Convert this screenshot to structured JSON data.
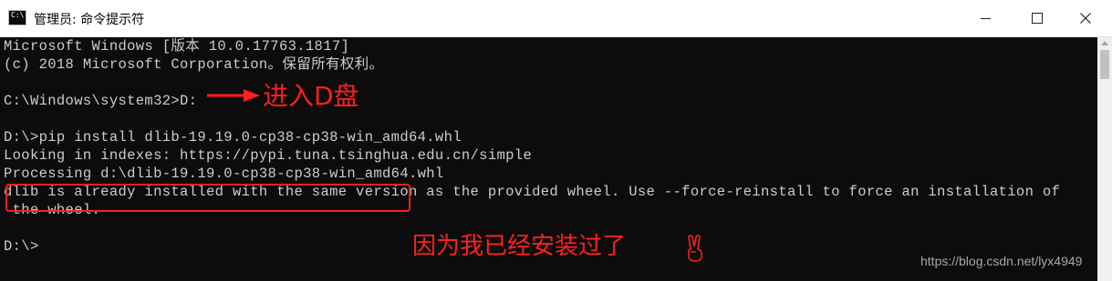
{
  "window": {
    "title": "管理员: 命令提示符",
    "icon_text": "C:\\"
  },
  "console": {
    "lines": [
      "Microsoft Windows [版本 10.0.17763.1817]",
      "(c) 2018 Microsoft Corporation。保留所有权利。",
      "",
      "C:\\Windows\\system32>D:",
      "",
      "D:\\>pip install dlib-19.19.0-cp38-cp38-win_amd64.whl",
      "Looking in indexes: https://pypi.tuna.tsinghua.edu.cn/simple",
      "Processing d:\\dlib-19.19.0-cp38-cp38-win_amd64.whl",
      "dlib is already installed with the same version as the provided wheel. Use --force-reinstall to force an installation of",
      " the wheel.",
      "",
      "D:\\>"
    ]
  },
  "annotations": {
    "enter_d": "进入D盘",
    "already_installed": "因为我已经安装过了"
  },
  "watermark": "https://blog.csdn.net/lyx4949",
  "colors": {
    "console_bg": "#0c0c0c",
    "console_text": "#cccccc",
    "annotation": "#ff2020"
  },
  "icons": [
    "console-app-icon",
    "minimize-icon",
    "maximize-icon",
    "close-icon",
    "annotation-arrow-icon",
    "victory-hand-icon"
  ]
}
